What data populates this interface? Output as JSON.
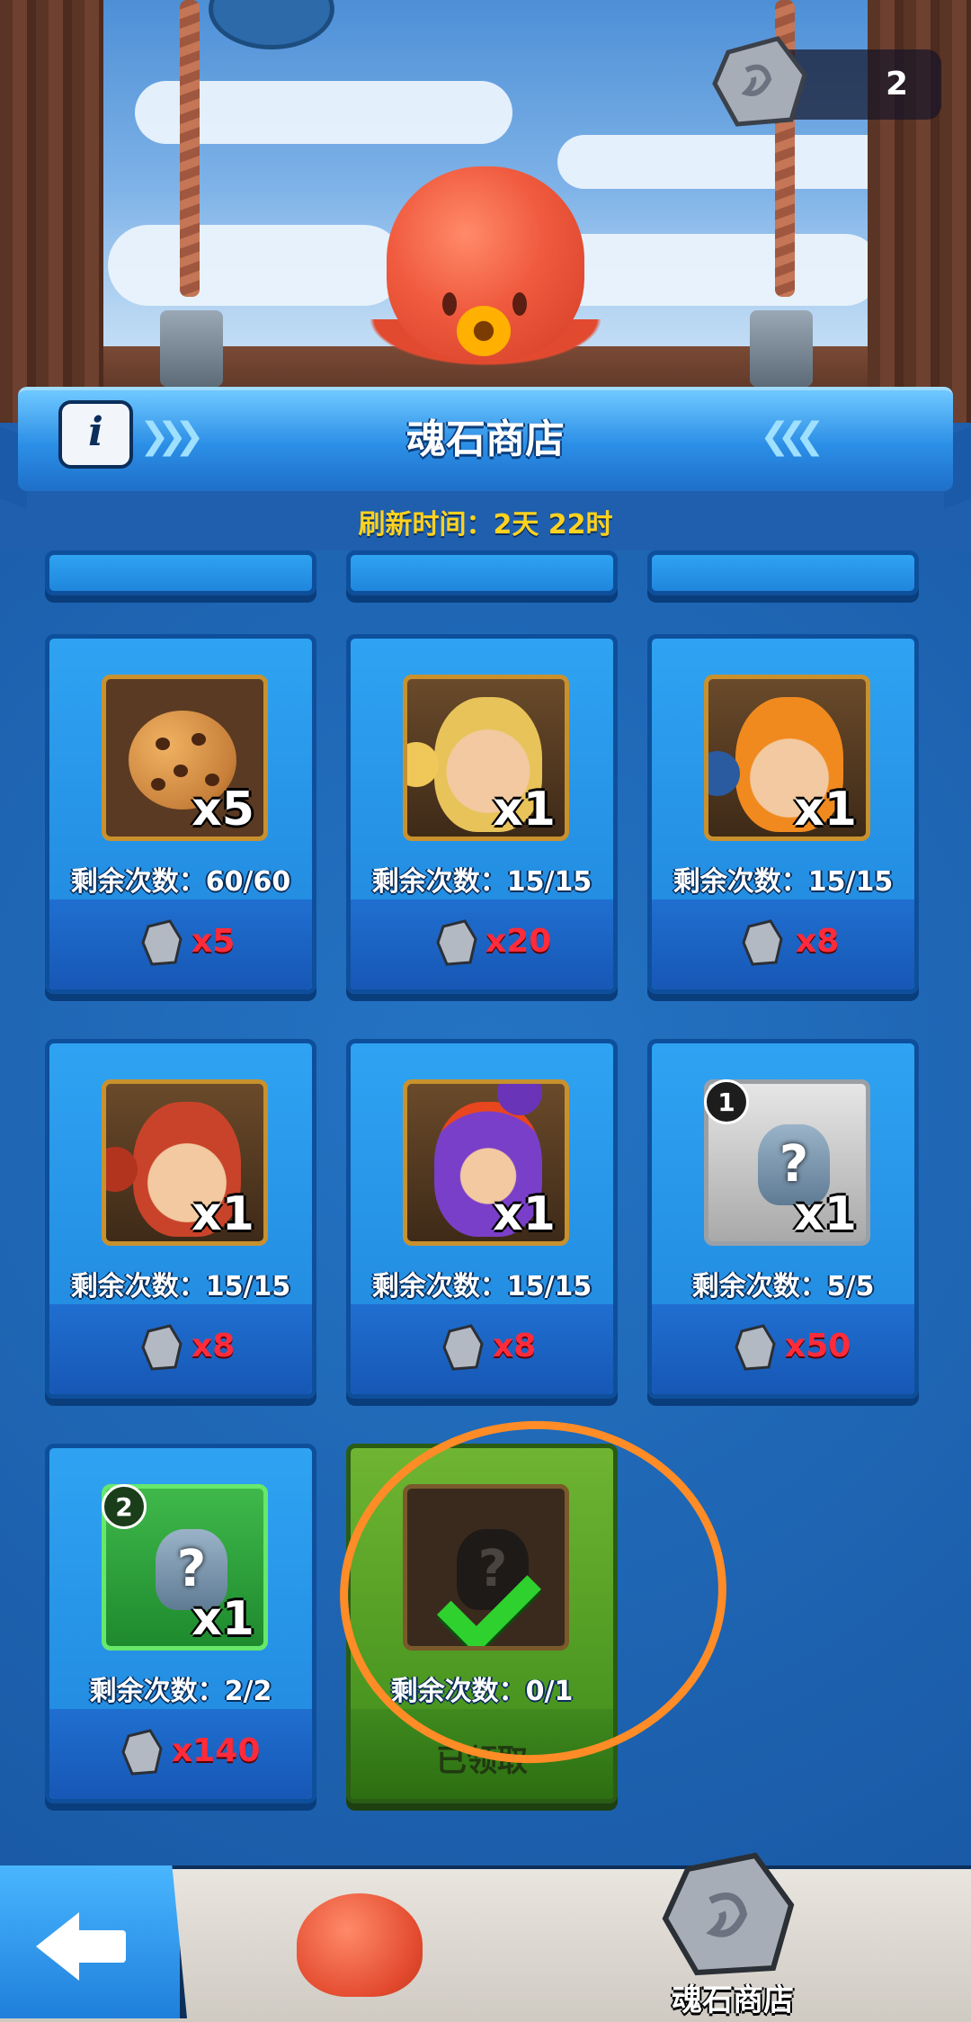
{
  "currency": {
    "amount": "2",
    "icon": "soul-stone-icon"
  },
  "header": {
    "title": "魂石商店",
    "refresh_text": "刷新时间：2天 22时",
    "info_label": "i"
  },
  "items": [
    {
      "thumb": "cookie-icon",
      "qty": "x5",
      "remain": "剩余次数：60/60",
      "price": "x5"
    },
    {
      "thumb": "hero-blonde-puzzle-icon",
      "qty": "x1",
      "remain": "剩余次数：15/15",
      "price": "x20"
    },
    {
      "thumb": "hero-orange-hood-puzzle-icon",
      "qty": "x1",
      "remain": "剩余次数：15/15",
      "price": "x8"
    },
    {
      "thumb": "hero-red-hair-puzzle-icon",
      "qty": "x1",
      "remain": "剩余次数：15/15",
      "price": "x8"
    },
    {
      "thumb": "hero-purple-ninja-puzzle-icon",
      "qty": "x1",
      "remain": "剩余次数：15/15",
      "price": "x8"
    },
    {
      "thumb": "mystery-stone-gray-icon",
      "level": "1",
      "qty": "x1",
      "remain": "剩余次数：5/5",
      "price": "x50"
    },
    {
      "thumb": "mystery-stone-green-icon",
      "level": "2",
      "qty": "x1",
      "remain": "剩余次数：2/2",
      "price": "x140"
    },
    {
      "thumb": "mystery-hero-silhouette-icon",
      "qty": "",
      "remain": "剩余次数：0/1",
      "status": "已领取"
    }
  ],
  "bottom_nav": {
    "shop_label": "魂石商店"
  },
  "colors": {
    "accent": "#2b8ee6",
    "price": "#ff2b3a",
    "refresh": "#ffd21f",
    "annotation": "#ff8c26"
  }
}
